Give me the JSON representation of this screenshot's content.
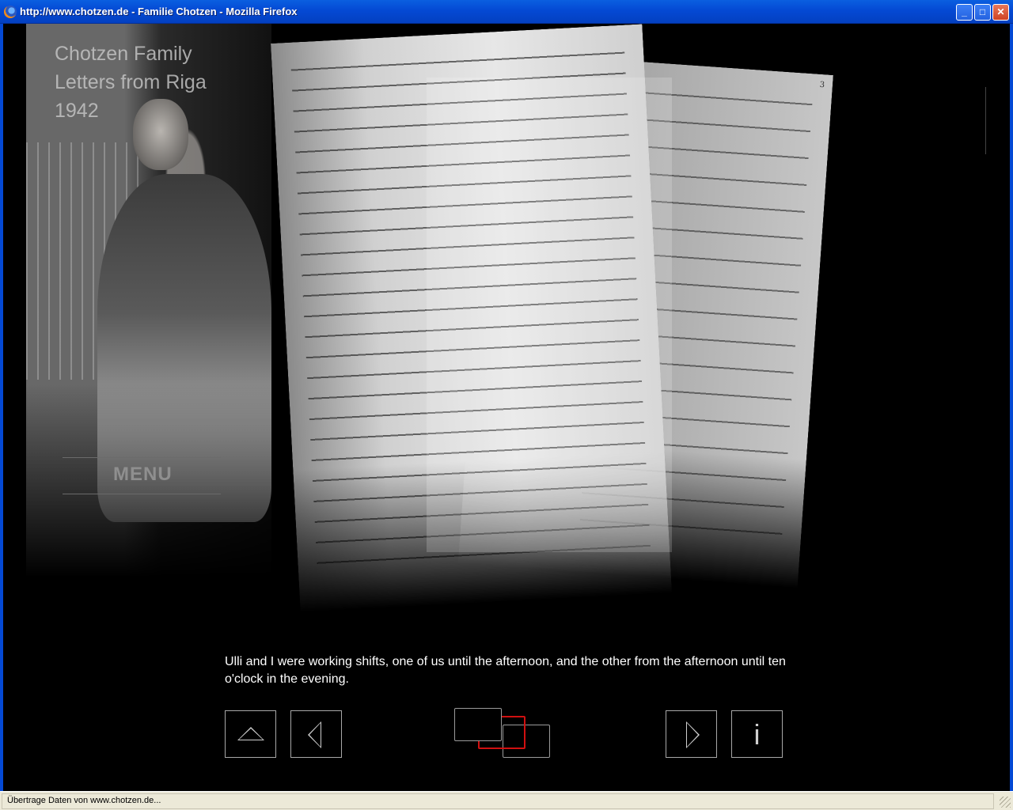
{
  "window": {
    "title": "http://www.chotzen.de - Familie Chotzen - Mozilla Firefox",
    "minimize_label": "_",
    "maximize_label": "□",
    "close_label": "✕"
  },
  "page": {
    "heading_lines": [
      "Chotzen Family",
      "Letters from Riga",
      "1942"
    ],
    "menu_label": "MENU",
    "caption": "Ulli and I were working shifts, one of us until the afternoon, and the other from the afternoon until ten o'clock in the evening.",
    "letter_page_number": "3",
    "nav": {
      "up_icon": "triangle-up-icon",
      "previous_icon": "triangle-left-icon",
      "pages_icon": "stacked-pages-icon",
      "next_icon": "triangle-right-icon",
      "info_label": "i"
    },
    "accent_color": "#d01010"
  },
  "statusbar": {
    "text": "Übertrage Daten von www.chotzen.de..."
  }
}
